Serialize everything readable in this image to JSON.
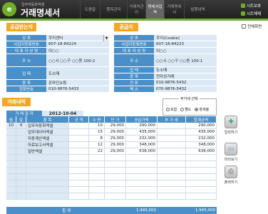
{
  "app": {
    "logo_letter": "e",
    "brand_sub": "업무자동화엑셀",
    "brand_title": "거래명세서"
  },
  "nav": [
    {
      "label": "도움말"
    },
    {
      "label": "품목관리"
    },
    {
      "label": "거래처관리"
    },
    {
      "label": "명세서입력"
    },
    {
      "label": "거래명세서"
    },
    {
      "label": "발행내역"
    }
  ],
  "sys": {
    "save_label": "시트보호",
    "unprotect_label": "시트해제"
  },
  "fullscreen_label": "전체화면",
  "receiver": {
    "title": "공급받는자",
    "rows": [
      {
        "label": "상 호",
        "value": "쿠키센터"
      },
      {
        "label": "사업자등록번호",
        "value": "607-18-84224"
      },
      {
        "label": "대 표 자 성 명",
        "value": "이○○"
      },
      {
        "label": "주 소",
        "value": "○○시 ○○구 ○○동 100-2"
      },
      {
        "label": "업 태",
        "value": "도소매"
      },
      {
        "label": "종 목",
        "value": "온라인쇼핑"
      },
      {
        "label": "전화번호",
        "value": "010-9876-5433"
      }
    ]
  },
  "supplier": {
    "title": "공급자",
    "rows": [
      {
        "label": "상 호",
        "value": "쿠키(Cookie)"
      },
      {
        "label": "사업자등록번호",
        "value": "607-18-84223"
      },
      {
        "label": "대 표 자 성 명",
        "value": "이○○"
      },
      {
        "label": "주 소",
        "value": "○○시 ○○구 ○○동 100-1"
      },
      {
        "label": "업 태",
        "value": "도소매"
      },
      {
        "label": "종 목",
        "value": "전자상거래"
      },
      {
        "label": "전 화",
        "value": "010-9876-5432"
      },
      {
        "label": "팩 스",
        "value": "070-9876-5432"
      }
    ]
  },
  "transaction": {
    "title": "거래내역",
    "date_label": "거 래 일 자",
    "date_value": "2012-10-04",
    "vat": {
      "title": "부가세 선택",
      "options": [
        "포함",
        "별도",
        "영세율"
      ],
      "selected": "영세율"
    },
    "columns": [
      "월",
      "일",
      "품 목",
      "규 격",
      "수 량",
      "단 가",
      "공급가액",
      "부 가 세",
      "합계금액"
    ],
    "rows": [
      {
        "month": "10",
        "day": "4",
        "item": "업무자동화엑셀",
        "spec": "",
        "qty": "10",
        "price": "29,000",
        "supply": "290,000",
        "vat": "",
        "total": "290,000"
      },
      {
        "month": "",
        "day": "",
        "item": "업무데이터엑셀",
        "spec": "",
        "qty": "15",
        "price": "29,000",
        "supply": "435,000",
        "vat": "",
        "total": "435,000"
      },
      {
        "month": "",
        "day": "",
        "item": "자동계산엑셀",
        "spec": "",
        "qty": "8",
        "price": "29,000",
        "supply": "232,000",
        "vat": "",
        "total": "232,000"
      },
      {
        "month": "",
        "day": "",
        "item": "자료보고서엑셀",
        "spec": "",
        "qty": "12",
        "price": "29,000",
        "supply": "348,000",
        "vat": "",
        "total": "348,000"
      },
      {
        "month": "",
        "day": "",
        "item": "일반엑셀",
        "spec": "",
        "qty": "22",
        "price": "29,000",
        "supply": "638,000",
        "vat": "",
        "total": "638,000"
      },
      {
        "month": "",
        "day": "",
        "item": "",
        "spec": "",
        "qty": "",
        "price": "",
        "supply": "",
        "vat": "",
        "total": ""
      },
      {
        "month": "",
        "day": "",
        "item": "",
        "spec": "",
        "qty": "",
        "price": "",
        "supply": "",
        "vat": "",
        "total": ""
      },
      {
        "month": "",
        "day": "",
        "item": "",
        "spec": "",
        "qty": "",
        "price": "",
        "supply": "",
        "vat": "",
        "total": ""
      },
      {
        "month": "",
        "day": "",
        "item": "",
        "spec": "",
        "qty": "",
        "price": "",
        "supply": "",
        "vat": "",
        "total": ""
      },
      {
        "month": "",
        "day": "",
        "item": "",
        "spec": "",
        "qty": "",
        "price": "",
        "supply": "",
        "vat": "",
        "total": ""
      },
      {
        "month": "",
        "day": "",
        "item": "",
        "spec": "",
        "qty": "",
        "price": "",
        "supply": "",
        "vat": "",
        "total": ""
      },
      {
        "month": "",
        "day": "",
        "item": "",
        "spec": "",
        "qty": "",
        "price": "",
        "supply": "",
        "vat": "",
        "total": ""
      }
    ],
    "total": {
      "label": "합 계",
      "supply": "1,945,000",
      "vat": "",
      "total": "1,945,000"
    }
  },
  "actions": [
    {
      "label": "입력하기",
      "icon": "plus-icon"
    },
    {
      "label": "미리보기",
      "icon": "monitor-icon"
    },
    {
      "label": "출력하기",
      "icon": "printer-icon"
    }
  ],
  "colors": {
    "accent_green": "#6fae2a",
    "header_blue": "#4a8fc7",
    "title_orange": "#f5a623",
    "cell_blue": "#dce9f5"
  }
}
